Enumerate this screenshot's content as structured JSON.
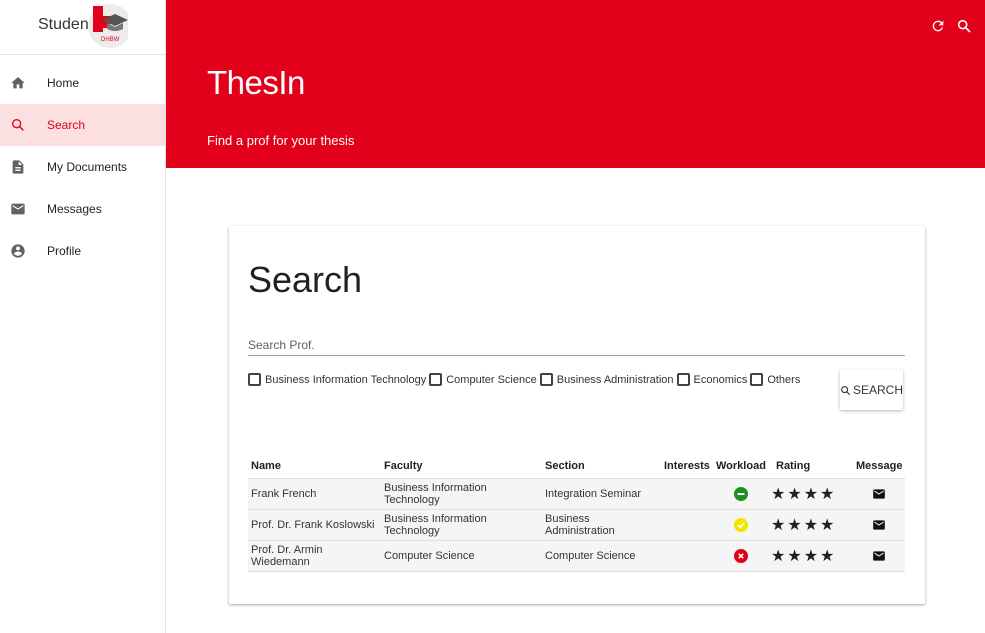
{
  "brand": {
    "name": "Student",
    "logo_text": "DHBW"
  },
  "sidebar": {
    "items": [
      {
        "label": "Home",
        "icon": "home-icon"
      },
      {
        "label": "Search",
        "icon": "search-icon",
        "active": true
      },
      {
        "label": "My Documents",
        "icon": "document-icon"
      },
      {
        "label": "Messages",
        "icon": "mail-icon"
      },
      {
        "label": "Profile",
        "icon": "account-icon"
      }
    ]
  },
  "header": {
    "title": "ThesIn",
    "subtitle": "Find a prof for your thesis",
    "actions": [
      "refresh-icon",
      "search-icon"
    ],
    "color": "#e2001a"
  },
  "card": {
    "title": "Search",
    "search_placeholder": "Search Prof.",
    "filters": [
      {
        "label": "Business Information Technology",
        "checked": false
      },
      {
        "label": "Computer Science",
        "checked": false
      },
      {
        "label": "Business Administration",
        "checked": false
      },
      {
        "label": "Economics",
        "checked": false
      },
      {
        "label": "Others",
        "checked": false
      }
    ],
    "search_button": "SEARCH"
  },
  "table": {
    "headers": [
      "Name",
      "Faculty",
      "Section",
      "Interests",
      "Workload",
      "Rating",
      "Message"
    ],
    "rows": [
      {
        "name": "Frank French",
        "faculty": "Business Information Technology",
        "section": "Integration Seminar",
        "interests": "",
        "workload": "busy",
        "rating": 4
      },
      {
        "name": "Prof. Dr. Frank Koslowski",
        "faculty": "Business Information Technology",
        "section": "Business Administration",
        "interests": "",
        "workload": "ok",
        "rating": 4
      },
      {
        "name": "Prof. Dr. Armin Wiedemann",
        "faculty": "Computer Science",
        "section": "Computer Science",
        "interests": "",
        "workload": "full",
        "rating": 4
      }
    ]
  },
  "colors": {
    "accent": "#e2001a",
    "workload_busy": "#1e8e1e",
    "workload_ok": "#f2e600",
    "workload_full": "#e2001a"
  }
}
